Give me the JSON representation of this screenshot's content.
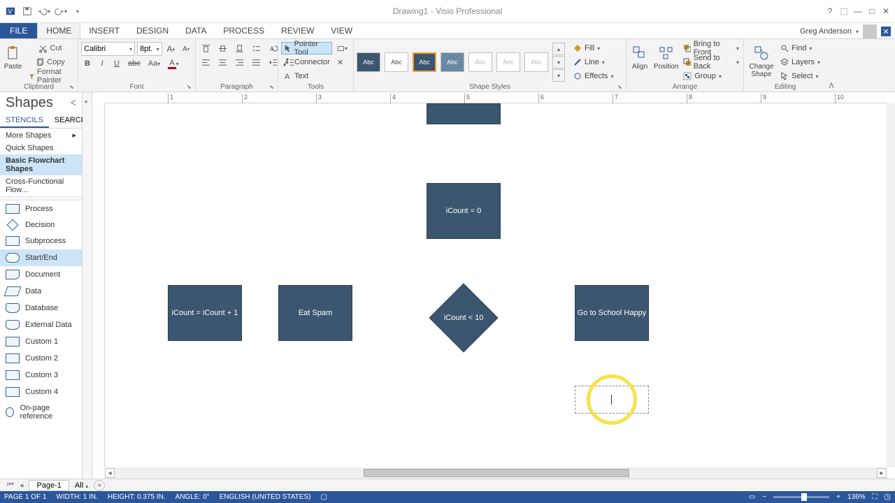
{
  "title": "Drawing1 - Visio Professional",
  "user": "Greg Anderson",
  "tabs": {
    "file": "FILE",
    "list": [
      "HOME",
      "INSERT",
      "DESIGN",
      "DATA",
      "PROCESS",
      "REVIEW",
      "VIEW"
    ],
    "active": 0
  },
  "ribbon": {
    "clipboard": {
      "paste": "Paste",
      "cut": "Cut",
      "copy": "Copy",
      "formatPainter": "Format Painter",
      "label": "Clipboard"
    },
    "font": {
      "name": "Calibri",
      "size": "8pt.",
      "label": "Font"
    },
    "paragraph": {
      "label": "Paragraph"
    },
    "tools": {
      "pointer": "Pointer Tool",
      "connector": "Connector",
      "text": "Text",
      "label": "Tools"
    },
    "styles": {
      "swatch": "Abc",
      "label": "Shape Styles",
      "fill": "Fill",
      "line": "Line",
      "effects": "Effects"
    },
    "arrange": {
      "align": "Align",
      "position": "Position",
      "bringFront": "Bring to Front",
      "sendBack": "Send to Back",
      "group": "Group",
      "label": "Arrange"
    },
    "editing": {
      "changeShape": "Change Shape",
      "find": "Find",
      "layers": "Layers",
      "select": "Select",
      "label": "Editing"
    }
  },
  "shapesPane": {
    "title": "Shapes",
    "tabs": [
      "STENCILS",
      "SEARCH"
    ],
    "moreShapes": "More Shapes",
    "quickShapes": "Quick Shapes",
    "stencils": [
      "Basic Flowchart Shapes",
      "Cross-Functional Flow..."
    ],
    "shapes": [
      "Process",
      "Decision",
      "Subprocess",
      "Start/End",
      "Document",
      "Data",
      "Database",
      "External Data",
      "Custom 1",
      "Custom 2",
      "Custom 3",
      "Custom 4",
      "On-page reference"
    ]
  },
  "rulerTicks": [
    "1",
    "2",
    "3",
    "4",
    "5",
    "6",
    "7",
    "8",
    "9",
    "10"
  ],
  "canvasShapes": {
    "topFragment": "",
    "init": "iCount = 0",
    "increment": "iCount = iCount + 1",
    "eat": "Eat Spam",
    "cond": "iCount < 10",
    "school": "Go to School Happy"
  },
  "pageTabs": {
    "page": "Page-1",
    "all": "All"
  },
  "status": {
    "page": "PAGE 1 OF 1",
    "width": "WIDTH: 1 IN.",
    "height": "HEIGHT: 0.375 IN.",
    "angle": "ANGLE: 0°",
    "lang": "ENGLISH (UNITED STATES)",
    "zoom": "136%"
  }
}
